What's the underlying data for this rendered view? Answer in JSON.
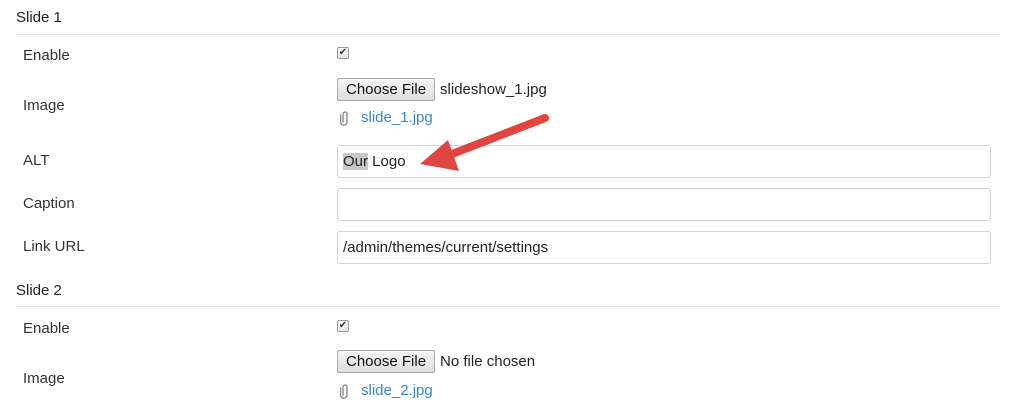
{
  "slides": [
    {
      "title": "Slide 1",
      "enable_label": "Enable",
      "enabled": true,
      "checkbox_glyph": "✔",
      "image_label": "Image",
      "file_button_label": "Choose File",
      "file_chosen": "slideshow_1.jpg",
      "attachment_icon": "paperclip-icon",
      "current_file": "slide_1.jpg",
      "alt_label": "ALT",
      "alt_value_selected": "Our",
      "alt_value_rest": " Logo",
      "caption_label": "Caption",
      "caption_value": "",
      "link_label": "Link URL",
      "link_value": "/admin/themes/current/settings"
    },
    {
      "title": "Slide 2",
      "enable_label": "Enable",
      "enabled": true,
      "checkbox_glyph": "✔",
      "image_label": "Image",
      "file_button_label": "Choose File",
      "file_chosen": "No file chosen",
      "attachment_icon": "paperclip-icon",
      "current_file": "slide_2.jpg"
    }
  ],
  "colors": {
    "link": "#3b87c8",
    "annotation_arrow": "#e0463f",
    "selection_highlight": "#c8c8c8"
  },
  "annotation": {
    "icon": "red-arrow-icon",
    "points_to": "alt-input"
  }
}
